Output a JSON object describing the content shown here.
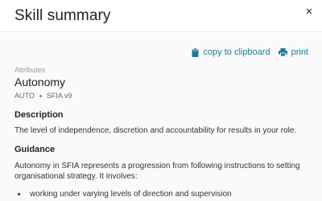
{
  "header": {
    "title": "Skill summary",
    "close_label": "×"
  },
  "actions": {
    "copy_label": "copy to clipboard",
    "print_label": "print",
    "accent_color": "#1f7a99"
  },
  "attributes": {
    "section_label": "Attributes",
    "name": "Autonomy",
    "code": "AUTO",
    "version": "SFIA v9"
  },
  "description": {
    "heading": "Description",
    "text": "The level of independence, discretion and accountability for results in your role."
  },
  "guidance": {
    "heading": "Guidance",
    "text": "Autonomy in SFIA represents a progression from following instructions to setting organisational strategy. It involves:",
    "items": [
      "working under varying levels of direction and supervision"
    ]
  }
}
